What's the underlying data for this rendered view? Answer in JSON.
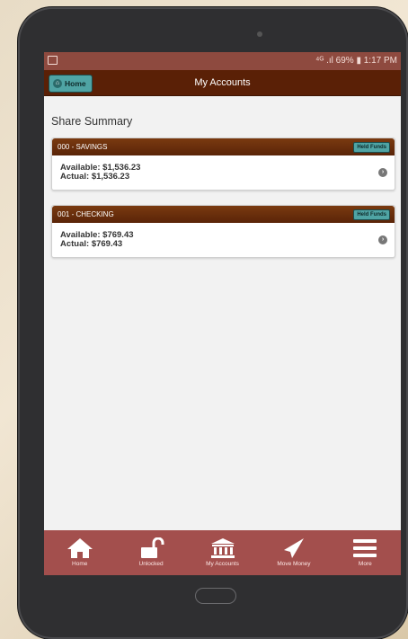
{
  "status_bar": {
    "right_text": "⁴ᴳ .ıl 69% ▮ 1:17 PM"
  },
  "header": {
    "home_label": "Home",
    "title": "My Accounts"
  },
  "section_title": "Share Summary",
  "accounts": [
    {
      "name": "000 - SAVINGS",
      "badge": "Held Funds",
      "available": "Available: $1,536.23",
      "actual": "Actual: $1,536.23"
    },
    {
      "name": "001 - CHECKING",
      "badge": "Held Funds",
      "available": "Available: $769.43",
      "actual": "Actual: $769.43"
    }
  ],
  "bottom_nav": [
    {
      "label": "Home",
      "icon": "home-icon"
    },
    {
      "label": "Unlocked",
      "icon": "unlock-icon"
    },
    {
      "label": "My Accounts",
      "icon": "bank-icon"
    },
    {
      "label": "Move Money",
      "icon": "paper-plane-icon"
    },
    {
      "label": "More",
      "icon": "menu-icon"
    }
  ],
  "colors": {
    "header": "#5a2006",
    "status_bar": "#8e4a3f",
    "bottom_bar": "#a34f4d",
    "accent_teal": "#4fa4a4"
  }
}
